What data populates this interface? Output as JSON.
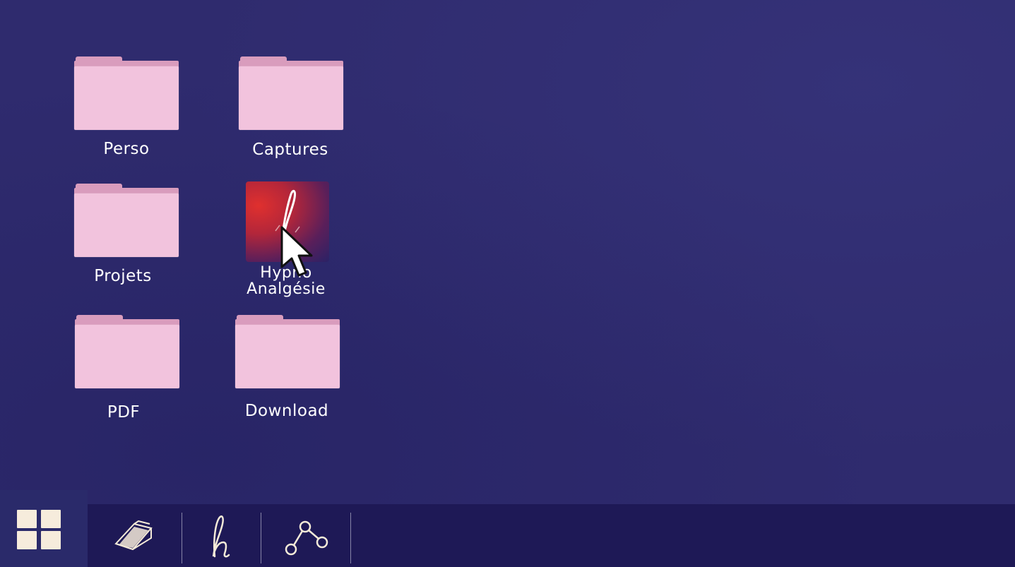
{
  "desktop": {
    "icons": [
      {
        "label": "Perso",
        "type": "folder"
      },
      {
        "label": "Captures",
        "type": "folder"
      },
      {
        "label": "Projets",
        "type": "folder"
      },
      {
        "label_line1": "Hypno",
        "label_line2": "Analgésie",
        "type": "app",
        "glyph": "ℓ"
      },
      {
        "label": "PDF",
        "type": "folder"
      },
      {
        "label": "Download",
        "type": "folder"
      }
    ]
  },
  "taskbar": {
    "start_icon": "windows-grid-icon",
    "items": [
      {
        "icon": "folder-sketch-icon"
      },
      {
        "icon": "letter-h-icon",
        "glyph": "h"
      },
      {
        "icon": "graph-nodes-icon"
      }
    ]
  },
  "colors": {
    "desktop_bg": "#2f2b6e",
    "taskbar_bg": "#1e1956",
    "start_bg": "#2a2a6a",
    "folder_front": "#f2c3dd",
    "folder_back": "#d99cbd",
    "text": "#ffffff"
  }
}
